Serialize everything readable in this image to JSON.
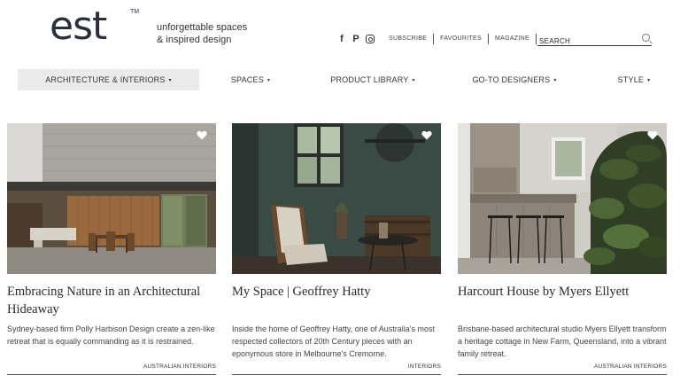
{
  "brand": {
    "logo": "est",
    "tm": "TM",
    "tagline_line1": "unforgettable spaces",
    "tagline_line2": "& inspired design"
  },
  "social": {
    "facebook_glyph": "f",
    "pinterest_glyph": "P"
  },
  "toplinks": {
    "subscribe": "SUBSCRIBE",
    "favourites": "FAVOURITES",
    "magazine": "MAGAZINE"
  },
  "search": {
    "placeholder": "SEARCH",
    "value": ""
  },
  "nav": {
    "items": [
      {
        "label": "ARCHITECTURE & INTERIORS",
        "caret": "▾"
      },
      {
        "label": "SPACES",
        "caret": "▾"
      },
      {
        "label": "PRODUCT LIBRARY",
        "caret": "▾"
      },
      {
        "label": "GO-TO DESIGNERS",
        "caret": "▾"
      },
      {
        "label": "STYLE",
        "caret": "▾"
      }
    ]
  },
  "cards": [
    {
      "title": "Embracing Nature in an Architectural Hideaway",
      "description": "Sydney-based firm Polly Harbison Design create a zen-like retreat that is equally commanding as it is restrained.",
      "category": "AUSTRALIAN INTERIORS"
    },
    {
      "title": "My Space | Geoffrey Hatty",
      "description": "Inside the home of Geoffrey Hatty, one of Australia's most respected collectors of 20th Century pieces with an eponymous store in Melbourne's Cremorne.",
      "category": "INTERIORS"
    },
    {
      "title": "Harcourt House by Myers Ellyett",
      "description": "Brisbane-based architectural studio Myers Ellyett transform a heritage cottage in New Farm, Queensland, into a vibrant family retreat.",
      "category": "AUSTRALIAN INTERIORS"
    }
  ],
  "colors": {
    "nav_active_bg": "#ebebeb",
    "text_dark": "#2a2f3a"
  }
}
